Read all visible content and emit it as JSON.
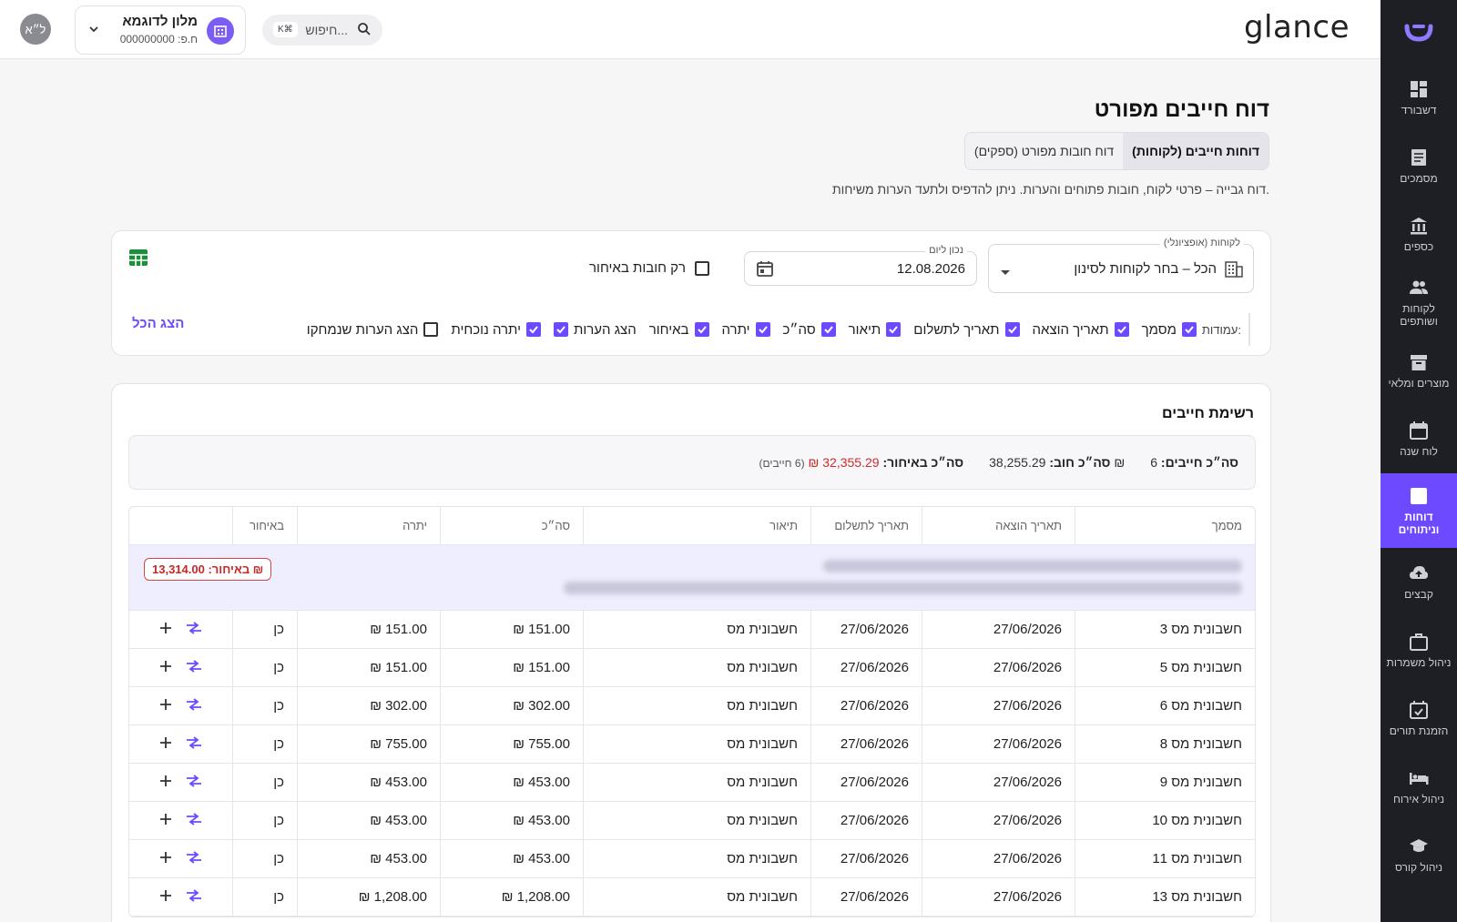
{
  "sidebar": {
    "items": [
      {
        "label": "דשבורד",
        "icon": "dashboard-icon"
      },
      {
        "label": "מסמכים",
        "icon": "document-icon"
      },
      {
        "label": "כספים",
        "icon": "bank-icon"
      },
      {
        "label": "לקוחות ושותפים",
        "icon": "people-icon"
      },
      {
        "label": "מוצרים ומלאי",
        "icon": "archive-icon"
      },
      {
        "label": "לוח שנה",
        "icon": "calendar-icon"
      },
      {
        "label": "דוחות וניתוחים",
        "icon": "chart-icon",
        "active": true
      },
      {
        "label": "קבצים",
        "icon": "cloud-upload-icon"
      },
      {
        "label": "ניהול משמרות",
        "icon": "briefcase-icon"
      },
      {
        "label": "הזמנת תורים",
        "icon": "calendar-check-icon"
      },
      {
        "label": "ניהול אירוח",
        "icon": "bed-icon"
      },
      {
        "label": "ניהול קורס",
        "icon": "school-icon"
      }
    ]
  },
  "topbar": {
    "brand": "glance",
    "avatar": "ל״א",
    "hotel_name": "מלון לדוגמא",
    "hotel_id": "ח.פ: 000000000",
    "search_placeholder": "חיפוש...",
    "search_shortcut": "K⌘"
  },
  "page": {
    "title": "דוח חייבים מפורט",
    "tabs": [
      "דוחות חייבים (לקוחות)",
      "דוח חובות מפורט (ספקים)"
    ],
    "description": "דוח גבייה – פרטי לקוח, חובות פתוחים והערות. ניתן להדפיס ולתעד הערות משיחות."
  },
  "filters": {
    "customers_label": "לקוחות (אופציונלי)",
    "customers_value": "הכל – בחר לקוחות לסינון",
    "date_label": "נכון ליום",
    "date_value": "12.08.2026",
    "only_late_label": "רק חובות באיחור",
    "columns_label": "עמודות:",
    "columns": [
      {
        "label": "מסמך",
        "checked": true
      },
      {
        "label": "תאריך הוצאה",
        "checked": true
      },
      {
        "label": "תאריך לתשלום",
        "checked": true
      },
      {
        "label": "תיאור",
        "checked": true
      },
      {
        "label": "סה״כ",
        "checked": true
      },
      {
        "label": "יתרה",
        "checked": true
      },
      {
        "label": "באיחור",
        "checked": true
      },
      {
        "label": "הצג הערות",
        "checked": false,
        "no_box": true
      },
      {
        "label": "יתרה נוכחית",
        "checked": true
      },
      {
        "label": "הצג הערות שנמחקו",
        "checked": false
      }
    ],
    "show_all": "הצג הכל"
  },
  "list": {
    "title": "רשימת חייבים",
    "summary": {
      "total_debtors_label": "סה״כ חייבים:",
      "total_debtors_value": "6",
      "total_debt_label": "סה״כ חוב:",
      "total_debt_value": "38,255.29 ₪",
      "total_late_label": "סה״כ באיחור:",
      "total_late_value": "32,355.29 ₪",
      "late_count": "(6 חייבים)"
    },
    "headers": [
      "מסמך",
      "תאריך הוצאה",
      "תאריך לתשלום",
      "תיאור",
      "סה״כ",
      "יתרה",
      "באיחור",
      ""
    ],
    "group_badge": "באיחור: 13,314.00 ₪",
    "rows": [
      {
        "doc": "חשבונית מס 3",
        "issued": "27/06/2026",
        "due": "27/06/2026",
        "desc": "חשבונית מס",
        "total": "151.00 ₪",
        "balance": "151.00 ₪",
        "late": "כן"
      },
      {
        "doc": "חשבונית מס 5",
        "issued": "27/06/2026",
        "due": "27/06/2026",
        "desc": "חשבונית מס",
        "total": "151.00 ₪",
        "balance": "151.00 ₪",
        "late": "כן"
      },
      {
        "doc": "חשבונית מס 6",
        "issued": "27/06/2026",
        "due": "27/06/2026",
        "desc": "חשבונית מס",
        "total": "302.00 ₪",
        "balance": "302.00 ₪",
        "late": "כן"
      },
      {
        "doc": "חשבונית מס 8",
        "issued": "27/06/2026",
        "due": "27/06/2026",
        "desc": "חשבונית מס",
        "total": "755.00 ₪",
        "balance": "755.00 ₪",
        "late": "כן"
      },
      {
        "doc": "חשבונית מס 9",
        "issued": "27/06/2026",
        "due": "27/06/2026",
        "desc": "חשבונית מס",
        "total": "453.00 ₪",
        "balance": "453.00 ₪",
        "late": "כן"
      },
      {
        "doc": "חשבונית מס 10",
        "issued": "27/06/2026",
        "due": "27/06/2026",
        "desc": "חשבונית מס",
        "total": "453.00 ₪",
        "balance": "453.00 ₪",
        "late": "כן"
      },
      {
        "doc": "חשבונית מס 11",
        "issued": "27/06/2026",
        "due": "27/06/2026",
        "desc": "חשבונית מס",
        "total": "453.00 ₪",
        "balance": "453.00 ₪",
        "late": "כן"
      },
      {
        "doc": "חשבונית מס 13",
        "issued": "27/06/2026",
        "due": "27/06/2026",
        "desc": "חשבונית מס",
        "total": "1,208.00 ₪",
        "balance": "1,208.00 ₪",
        "late": "כן"
      }
    ]
  },
  "colors": {
    "accent": "#6d4aff",
    "sidebar": "#1e1f24",
    "late": "#d02b2b",
    "excel": "#1e8e3e"
  }
}
